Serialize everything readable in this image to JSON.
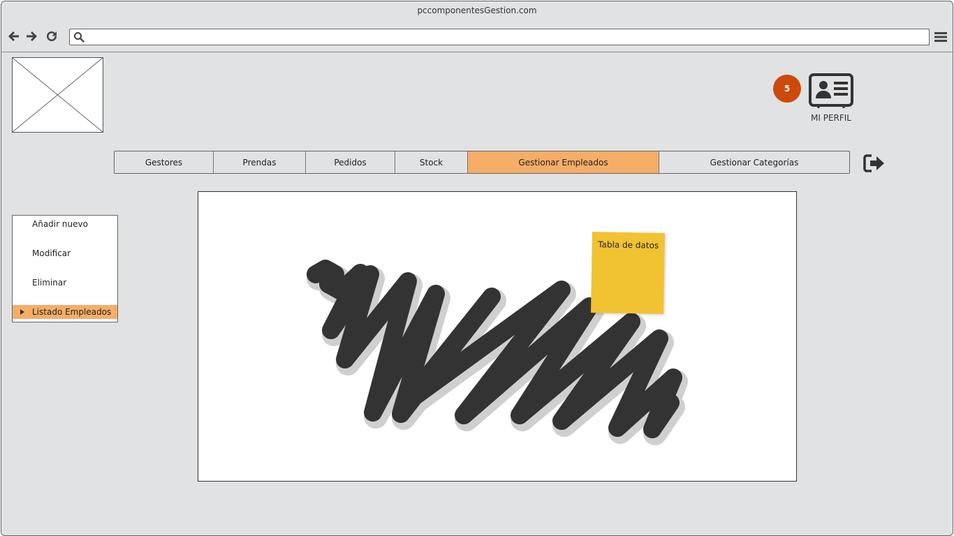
{
  "browser": {
    "title": "pccomponentesGestion.com",
    "url_value": "",
    "icons": [
      "back-arrow-icon",
      "forward-arrow-icon",
      "reload-icon",
      "search-icon",
      "hamburger-menu-icon"
    ]
  },
  "header": {
    "logo": "image-placeholder",
    "notification_count": "5",
    "notification_color": "#cc4a0a",
    "profile_label": "MI PERFIL",
    "profile_icon": "id-card-icon",
    "logout_icon": "logout-icon"
  },
  "tabs": [
    {
      "label": "Gestores",
      "active": false
    },
    {
      "label": "Prendas",
      "active": false
    },
    {
      "label": "Pedidos",
      "active": false
    },
    {
      "label": "Stock",
      "active": false
    },
    {
      "label": "Gestionar Empleados",
      "active": true
    },
    {
      "label": "Gestionar Categorías",
      "active": false
    }
  ],
  "sidebar": {
    "items": [
      {
        "label": "Añadir nuevo",
        "active": false
      },
      {
        "label": "Modificar",
        "active": false
      },
      {
        "label": "Eliminar",
        "active": false
      },
      {
        "label": "Listado Empleados",
        "active": true
      }
    ]
  },
  "main": {
    "sticky_note": "Tabla de datos",
    "sticky_color": "#f1c232"
  },
  "colors": {
    "accent": "#f6ad68",
    "background": "#e1e2e3"
  }
}
